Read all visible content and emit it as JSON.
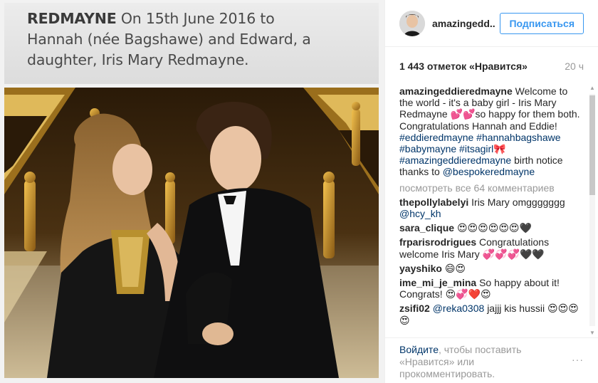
{
  "notice": {
    "surname": "REDMAYNE",
    "line1_rest": "On 15th June 2016 to",
    "line2": "Hannah (née Bagshawe) and Edward, a",
    "line3": "daughter, Iris Mary Redmayne."
  },
  "header": {
    "username": "amazingedd..",
    "follow_label": "Подписаться"
  },
  "stats": {
    "likes": "1 443 отметок «Нравится»",
    "time": "20 ч"
  },
  "caption": {
    "author": "amazingeddieredmayne",
    "text1": "Welcome to the world - it's a baby girl - Iris Mary Redmayne 💕💕so happy for them both. Congratulations Hannah and Eddie!",
    "tags": "#eddieredmayne #hannahbagshawe #babymayne #itsagirl🎀 #amazingeddieredmayne",
    "text2": "birth notice thanks to",
    "mention": "@bespokeredmayne"
  },
  "view_all": "посмотреть все 64 комментариев",
  "comments": [
    {
      "author": "thepollylabelyi",
      "text": "Iris Mary omggggggg",
      "mention": "@hcy_kh"
    },
    {
      "author": "sara_clique",
      "text": "😍😍😍😍😍😍🖤",
      "mention": ""
    },
    {
      "author": "frparisrodrigues",
      "text": "Congratulations welcome Iris Mary 💞💞💞🖤🖤",
      "mention": ""
    },
    {
      "author": "yayshiko",
      "text": "😄😍",
      "mention": ""
    },
    {
      "author": "ime_mi_je_mina",
      "text": "So happy about it! Congrats! 😍💞❤️😍",
      "mention": ""
    },
    {
      "author": "zsifi02",
      "mention": "@reka0308",
      "text": "jajjj kis hussii 😍😍😍😍"
    }
  ],
  "footer": {
    "login": "Войдите",
    "rest": ", чтобы поставить «Нравится» или прокомментировать.",
    "more": "···"
  },
  "colors": {
    "accent": "#3897f0",
    "link": "#003569",
    "muted": "#999999"
  }
}
